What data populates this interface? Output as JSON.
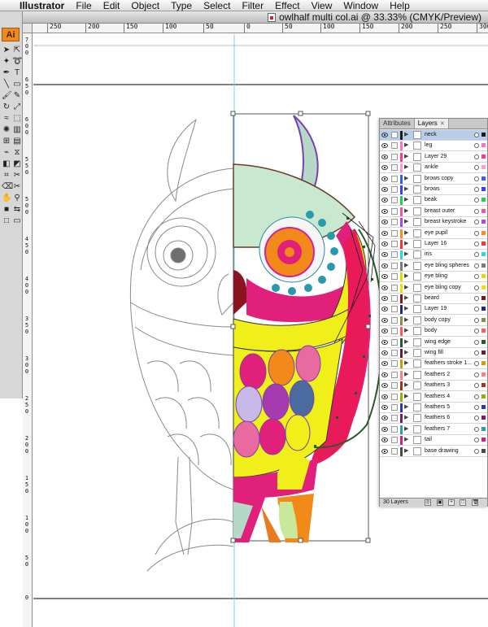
{
  "menubar": {
    "apple": "",
    "app_name": "Illustrator",
    "items": [
      "File",
      "Edit",
      "Object",
      "Type",
      "Select",
      "Filter",
      "Effect",
      "View",
      "Window",
      "Help"
    ]
  },
  "document": {
    "title": "owlhalf multi col.ai @ 33.33% (CMYK/Preview)"
  },
  "ruler": {
    "horizontal": [
      "250",
      "200",
      "150",
      "100",
      "50",
      "0",
      "50",
      "100",
      "150",
      "200",
      "250",
      "300"
    ],
    "vertical": [
      "700",
      "650",
      "600",
      "550",
      "500",
      "450",
      "400",
      "350",
      "300",
      "250",
      "200",
      "150",
      "100",
      "50",
      "0"
    ]
  },
  "tools": {
    "logo": "Ai",
    "icons": [
      "selection-tool",
      "direct-selection-tool",
      "magic-wand-tool",
      "lasso-tool",
      "pen-tool",
      "type-tool",
      "line-tool",
      "rectangle-tool",
      "paintbrush-tool",
      "pencil-tool",
      "rotate-tool",
      "scale-tool",
      "warp-tool",
      "free-transform-tool",
      "symbol-sprayer-tool",
      "column-graph-tool",
      "mesh-tool",
      "gradient-tool",
      "eyedropper-tool",
      "blend-tool",
      "live-paint-tool",
      "live-paint-selection-tool",
      "crop-tool",
      "slice-tool",
      "eraser-tool",
      "scissors-tool",
      "hand-tool",
      "zoom-tool",
      "fill-stroke-swatch",
      "swap-colors",
      "color-mode",
      "screen-mode"
    ]
  },
  "layers_panel": {
    "tabs": [
      "Attributes",
      "Layers"
    ],
    "active_tab": "Layers",
    "layer_count_label": "30 Layers",
    "layers": [
      {
        "name": "neck",
        "color": "#1a1a1a",
        "selected": true
      },
      {
        "name": "leg",
        "color": "#ff6ec7",
        "selected": false
      },
      {
        "name": "Layer 29",
        "color": "#ff3a8c",
        "selected": false
      },
      {
        "name": "ankle",
        "color": "#ff9ad0",
        "selected": false
      },
      {
        "name": "brows copy",
        "color": "#3a5cff",
        "selected": false
      },
      {
        "name": "brows",
        "color": "#3c3cff",
        "selected": false
      },
      {
        "name": "beak",
        "color": "#19d44a",
        "selected": false
      },
      {
        "name": "breast outer",
        "color": "#ff4fa0",
        "selected": false
      },
      {
        "name": "breast keystroke",
        "color": "#a64ae6",
        "selected": false
      },
      {
        "name": "eye pupil",
        "color": "#ff8c1a",
        "selected": false
      },
      {
        "name": "Layer 16",
        "color": "#ff3030",
        "selected": false
      },
      {
        "name": "iris",
        "color": "#2ad6e0",
        "selected": false
      },
      {
        "name": "eye bling spheres",
        "color": "#7a7a7a",
        "selected": false
      },
      {
        "name": "eye bling",
        "color": "#e8d800",
        "selected": false
      },
      {
        "name": "eye bling copy",
        "color": "#f0e000",
        "selected": false
      },
      {
        "name": "beard",
        "color": "#7a1a1a",
        "selected": false
      },
      {
        "name": "Layer 19",
        "color": "#1a2a8a",
        "selected": false
      },
      {
        "name": "body copy",
        "color": "#8c8c4a",
        "selected": false
      },
      {
        "name": "body",
        "color": "#ff5a5a",
        "selected": false
      },
      {
        "name": "wing edge",
        "color": "#2a5a2a",
        "selected": false
      },
      {
        "name": "wing fill",
        "color": "#6a1a3a",
        "selected": false
      },
      {
        "name": "feathers stroke 1...",
        "color": "#c8a000",
        "selected": false
      },
      {
        "name": "feathers 2",
        "color": "#ff8080",
        "selected": false
      },
      {
        "name": "feathers 3",
        "color": "#9a3a1a",
        "selected": false
      },
      {
        "name": "feathers 4",
        "color": "#8ab400",
        "selected": false
      },
      {
        "name": "feathers 5",
        "color": "#2a3aaa",
        "selected": false
      },
      {
        "name": "feathers 6",
        "color": "#7a1a6a",
        "selected": false
      },
      {
        "name": "feathers 7",
        "color": "#2aa0a0",
        "selected": false
      },
      {
        "name": "tail",
        "color": "#d02090",
        "selected": false
      },
      {
        "name": "base drawing",
        "color": "#4a4a4a",
        "selected": false
      }
    ]
  }
}
